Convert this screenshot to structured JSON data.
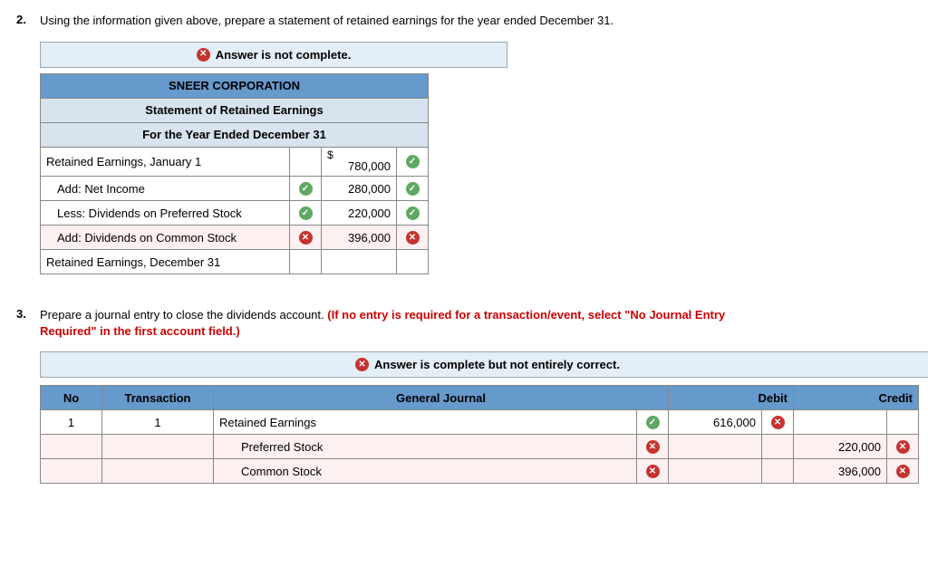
{
  "q2": {
    "num": "2.",
    "text": "Using the information given above, prepare a statement of retained earnings for the year ended December 31.",
    "banner": "Answer is not complete.",
    "header1": "SNEER CORPORATION",
    "header2": "Statement of Retained Earnings",
    "header3": "For the Year Ended December 31",
    "currency": "$",
    "rows": [
      {
        "label": "Retained Earnings, January 1",
        "indent": false,
        "lblOk": null,
        "value": "780,000",
        "valOk": true,
        "wrong": false
      },
      {
        "label": "Add: Net Income",
        "indent": true,
        "lblOk": true,
        "value": "280,000",
        "valOk": true,
        "wrong": false
      },
      {
        "label": "Less: Dividends on Preferred Stock",
        "indent": true,
        "lblOk": true,
        "value": "220,000",
        "valOk": true,
        "wrong": false
      },
      {
        "label": "Add: Dividends on Common Stock",
        "indent": true,
        "lblOk": false,
        "value": "396,000",
        "valOk": false,
        "wrong": true
      },
      {
        "label": "Retained Earnings, December 31",
        "indent": false,
        "lblOk": null,
        "value": "",
        "valOk": null,
        "wrong": false
      }
    ]
  },
  "q3": {
    "num": "3.",
    "text": "Prepare a journal entry to close the dividends account. ",
    "textRed": "(If no entry is required for a transaction/event, select \"No Journal Entry Required\" in the first account field.)",
    "banner": "Answer is complete but not entirely correct.",
    "cols": {
      "no": "No",
      "tr": "Transaction",
      "gj": "General Journal",
      "debit": "Debit",
      "credit": "Credit"
    },
    "rows": [
      {
        "no": "1",
        "tr": "1",
        "acct": "Retained Earnings",
        "indent": false,
        "acctOk": true,
        "debit": "616,000",
        "debitOk": false,
        "credit": "",
        "creditOk": null,
        "wrong": false
      },
      {
        "no": "",
        "tr": "",
        "acct": "Preferred Stock",
        "indent": true,
        "acctOk": false,
        "debit": "",
        "debitOk": null,
        "credit": "220,000",
        "creditOk": false,
        "wrong": true
      },
      {
        "no": "",
        "tr": "",
        "acct": "Common Stock",
        "indent": true,
        "acctOk": false,
        "debit": "",
        "debitOk": null,
        "credit": "396,000",
        "creditOk": false,
        "wrong": true
      }
    ]
  }
}
